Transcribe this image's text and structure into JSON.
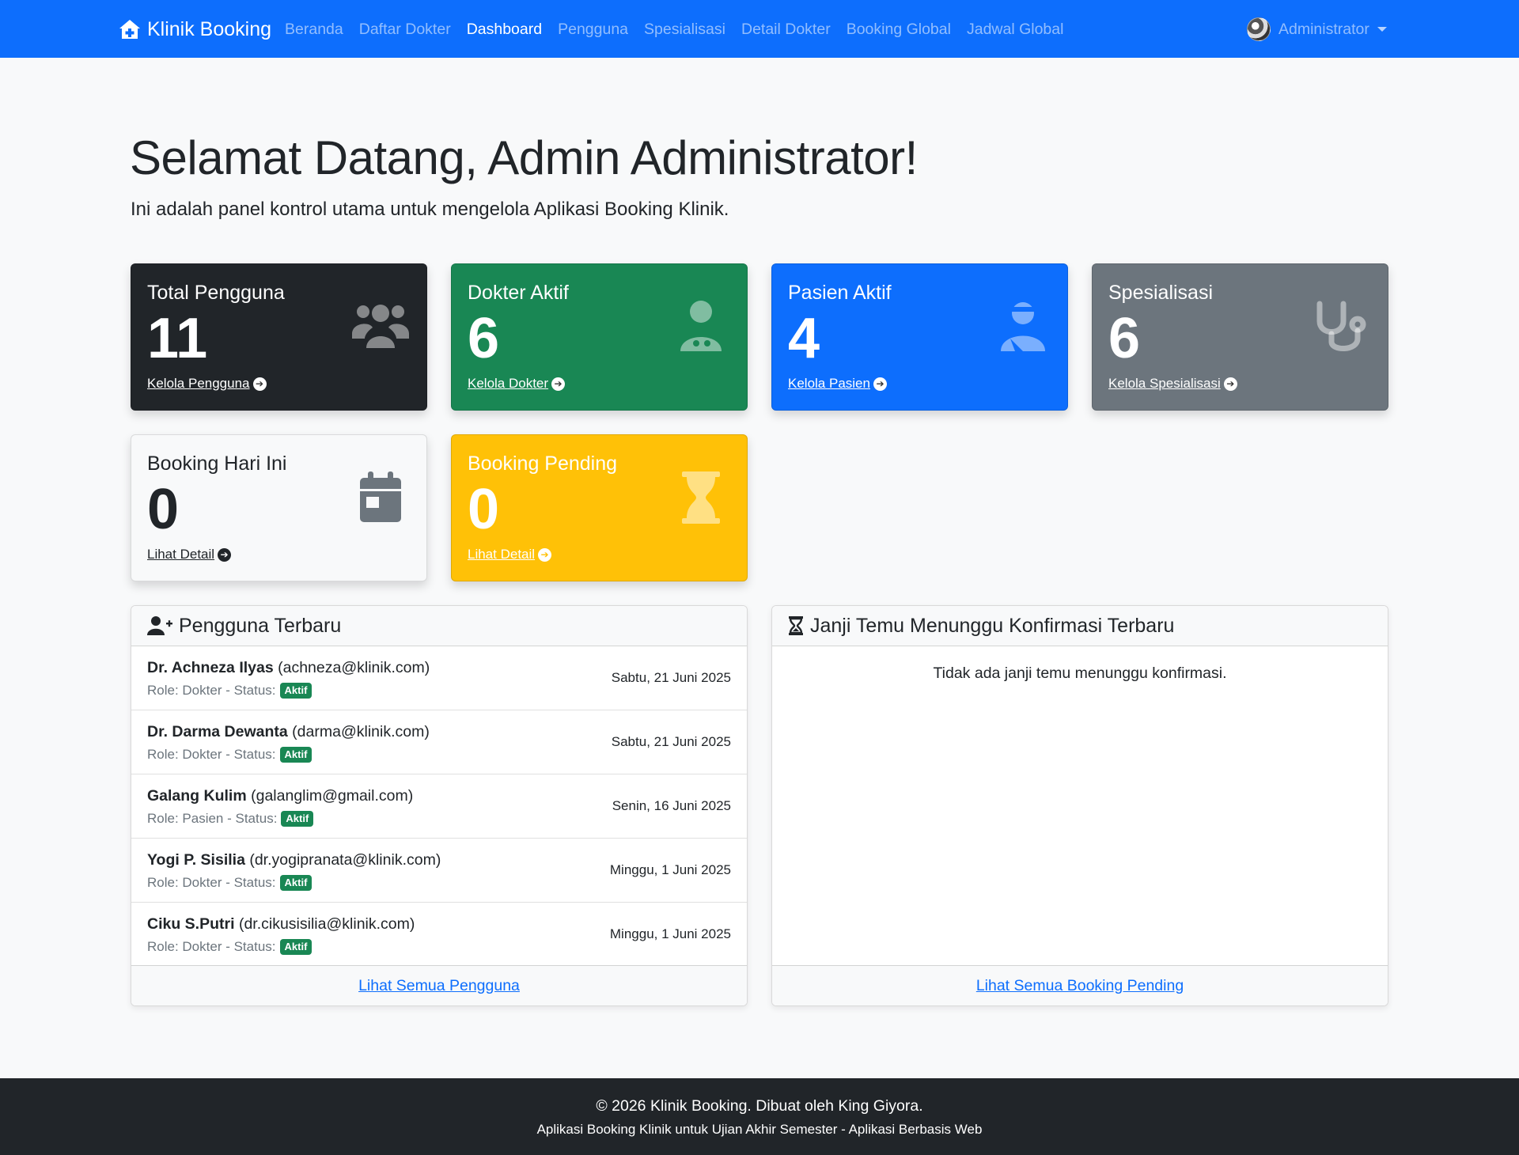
{
  "navbar": {
    "brand": "Klinik Booking",
    "brand_icon": "house-medical-icon",
    "links": [
      "Beranda",
      "Daftar Dokter",
      "Dashboard",
      "Pengguna",
      "Spesialisasi",
      "Detail Dokter",
      "Booking Global",
      "Jadwal Global"
    ],
    "active_link": "Dashboard",
    "user": "Administrator"
  },
  "hero": {
    "title": "Selamat Datang, Admin Administrator!",
    "subtitle": "Ini adalah panel kontrol utama untuk mengelola Aplikasi Booking Klinik."
  },
  "stats": [
    {
      "label": "Total Pengguna",
      "value": "11",
      "link": "Kelola Pengguna",
      "icon": "users-icon",
      "color": "#212529"
    },
    {
      "label": "Dokter Aktif",
      "value": "6",
      "link": "Kelola Dokter",
      "icon": "user-doctor-icon",
      "color": "#198754"
    },
    {
      "label": "Pasien Aktif",
      "value": "4",
      "link": "Kelola Pasien",
      "icon": "user-injured-icon",
      "color": "#0d6efd"
    },
    {
      "label": "Spesialisasi",
      "value": "6",
      "link": "Kelola Spesialisasi",
      "icon": "stethoscope-icon",
      "color": "#6c757d"
    },
    {
      "label": "Booking Hari Ini",
      "value": "0",
      "link": "Lihat Detail",
      "icon": "calendar-day-icon",
      "color": "#f8f9fa"
    },
    {
      "label": "Booking Pending",
      "value": "0",
      "link": "Lihat Detail",
      "icon": "hourglass-icon",
      "color": "#ffc107"
    }
  ],
  "recent_users": {
    "title": "Pengguna Terbaru",
    "items": [
      {
        "name": "Dr. Achneza Ilyas",
        "email": "(achneza@klinik.com)",
        "meta": "Role: Dokter - Status:",
        "status": "Aktif",
        "date": "Sabtu, 21 Juni 2025"
      },
      {
        "name": "Dr. Darma Dewanta",
        "email": "(darma@klinik.com)",
        "meta": "Role: Dokter - Status:",
        "status": "Aktif",
        "date": "Sabtu, 21 Juni 2025"
      },
      {
        "name": "Galang Kulim",
        "email": "(galanglim@gmail.com)",
        "meta": "Role: Pasien - Status:",
        "status": "Aktif",
        "date": "Senin, 16 Juni 2025"
      },
      {
        "name": "Yogi P. Sisilia",
        "email": "(dr.yogipranata@klinik.com)",
        "meta": "Role: Dokter - Status:",
        "status": "Aktif",
        "date": "Minggu, 1 Juni 2025"
      },
      {
        "name": "Ciku S.Putri",
        "email": "(dr.cikusisilia@klinik.com)",
        "meta": "Role: Dokter - Status:",
        "status": "Aktif",
        "date": "Minggu, 1 Juni 2025"
      }
    ],
    "footer_link": "Lihat Semua Pengguna"
  },
  "pending": {
    "title": "Janji Temu Menunggu Konfirmasi Terbaru",
    "empty": "Tidak ada janji temu menunggu konfirmasi.",
    "footer_link": "Lihat Semua Booking Pending"
  },
  "footer": {
    "line1": "© 2026 Klinik Booking. Dibuat oleh King Giyora.",
    "line2": "Aplikasi Booking Klinik untuk Ujian Akhir Semester - Aplikasi Berbasis Web"
  }
}
